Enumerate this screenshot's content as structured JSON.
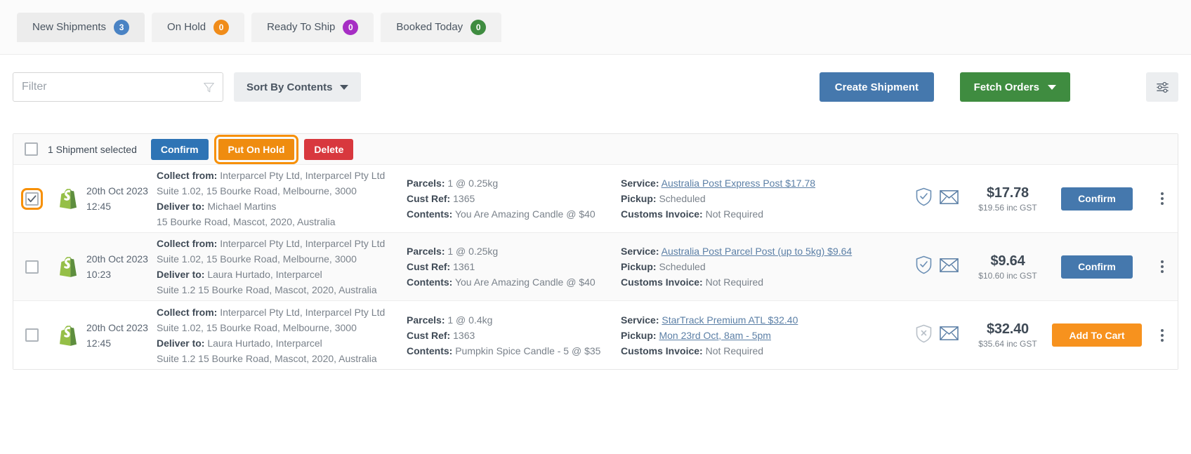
{
  "tabs": [
    {
      "label": "New Shipments",
      "count": "3",
      "color": "#4a83c4",
      "active": true
    },
    {
      "label": "On Hold",
      "count": "0",
      "color": "#f08c1a",
      "active": false
    },
    {
      "label": "Ready To Ship",
      "count": "0",
      "color": "#a62ec4",
      "active": false
    },
    {
      "label": "Booked Today",
      "count": "0",
      "color": "#3f8c40",
      "active": false
    }
  ],
  "toolbar": {
    "filter_value": "",
    "filter_placeholder": "Filter",
    "sort_label": "Sort By Contents",
    "create_shipment_label": "Create Shipment",
    "fetch_orders_label": "Fetch Orders",
    "settings_icon": "sliders-icon",
    "funnel_icon": "funnel-icon"
  },
  "action_bar": {
    "selection_text": "1 Shipment selected",
    "confirm_label": "Confirm",
    "put_on_hold_label": "Put On Hold",
    "delete_label": "Delete",
    "focused_button": "Put On Hold",
    "focus_color": "#f79007"
  },
  "labels": {
    "collect_from": "Collect from:",
    "deliver_to": "Deliver to:",
    "parcels": "Parcels:",
    "cust_ref": "Cust Ref:",
    "contents": "Contents:",
    "service": "Service:",
    "pickup": "Pickup:",
    "customs_invoice": "Customs Invoice:"
  },
  "rows": [
    {
      "selected": true,
      "focused": true,
      "source_icon": "shopify-icon",
      "date": "20th Oct 2023",
      "time": "12:45",
      "collect_from": "Interparcel Pty Ltd, Interparcel Pty Ltd",
      "collect_address": "Suite 1.02, 15 Bourke Road, Melbourne, 3000",
      "deliver_to": "Michael Martins",
      "deliver_address": "15 Bourke Road, Mascot, 2020, Australia",
      "parcels": "1 @ 0.25kg",
      "cust_ref": "1365",
      "contents": "You Are Amazing Candle @ $40",
      "service": "Australia Post Express Post $17.78",
      "service_is_link": true,
      "pickup": "Scheduled",
      "pickup_is_link": false,
      "customs_invoice": "Not Required",
      "shield_icon": "shield-check-icon",
      "shield_state": "active",
      "mail_icon": "envelope-icon",
      "price": "$17.78",
      "price_inc": "$19.56 inc GST",
      "action_label": "Confirm",
      "action_style": "blue",
      "menu_icon": "kebab-menu-icon",
      "shaded": false
    },
    {
      "selected": false,
      "focused": false,
      "source_icon": "shopify-icon",
      "date": "20th Oct 2023",
      "time": "10:23",
      "collect_from": "Interparcel Pty Ltd, Interparcel Pty Ltd",
      "collect_address": "Suite 1.02, 15 Bourke Road, Melbourne, 3000",
      "deliver_to": "Laura Hurtado, Interparcel",
      "deliver_address": "Suite 1.2 15 Bourke Road, Mascot, 2020, Australia",
      "parcels": "1 @ 0.25kg",
      "cust_ref": "1361",
      "contents": "You Are Amazing Candle @ $40",
      "service": "Australia Post Parcel Post (up to 5kg) $9.64",
      "service_is_link": true,
      "pickup": "Scheduled",
      "pickup_is_link": false,
      "customs_invoice": "Not Required",
      "shield_icon": "shield-check-icon",
      "shield_state": "active",
      "mail_icon": "envelope-icon",
      "price": "$9.64",
      "price_inc": "$10.60 inc GST",
      "action_label": "Confirm",
      "action_style": "blue",
      "menu_icon": "kebab-menu-icon",
      "shaded": true
    },
    {
      "selected": false,
      "focused": false,
      "source_icon": "shopify-icon",
      "date": "20th Oct 2023",
      "time": "12:45",
      "collect_from": "Interparcel Pty Ltd, Interparcel Pty Ltd",
      "collect_address": "Suite 1.02, 15 Bourke Road, Melbourne, 3000",
      "deliver_to": "Laura Hurtado, Interparcel",
      "deliver_address": "Suite 1.2 15 Bourke Road, Mascot, 2020, Australia",
      "parcels": "1 @ 0.4kg",
      "cust_ref": "1363",
      "contents": "Pumpkin Spice Candle - 5 @ $35",
      "service": "StarTrack Premium ATL $32.40",
      "service_is_link": true,
      "pickup": "Mon 23rd Oct, 8am - 5pm",
      "pickup_is_link": true,
      "customs_invoice": "Not Required",
      "shield_icon": "shield-cross-icon",
      "shield_state": "disabled",
      "mail_icon": "envelope-icon",
      "price": "$32.40",
      "price_inc": "$35.64 inc GST",
      "action_label": "Add To Cart",
      "action_style": "orange",
      "menu_icon": "kebab-menu-icon",
      "shaded": false
    }
  ]
}
